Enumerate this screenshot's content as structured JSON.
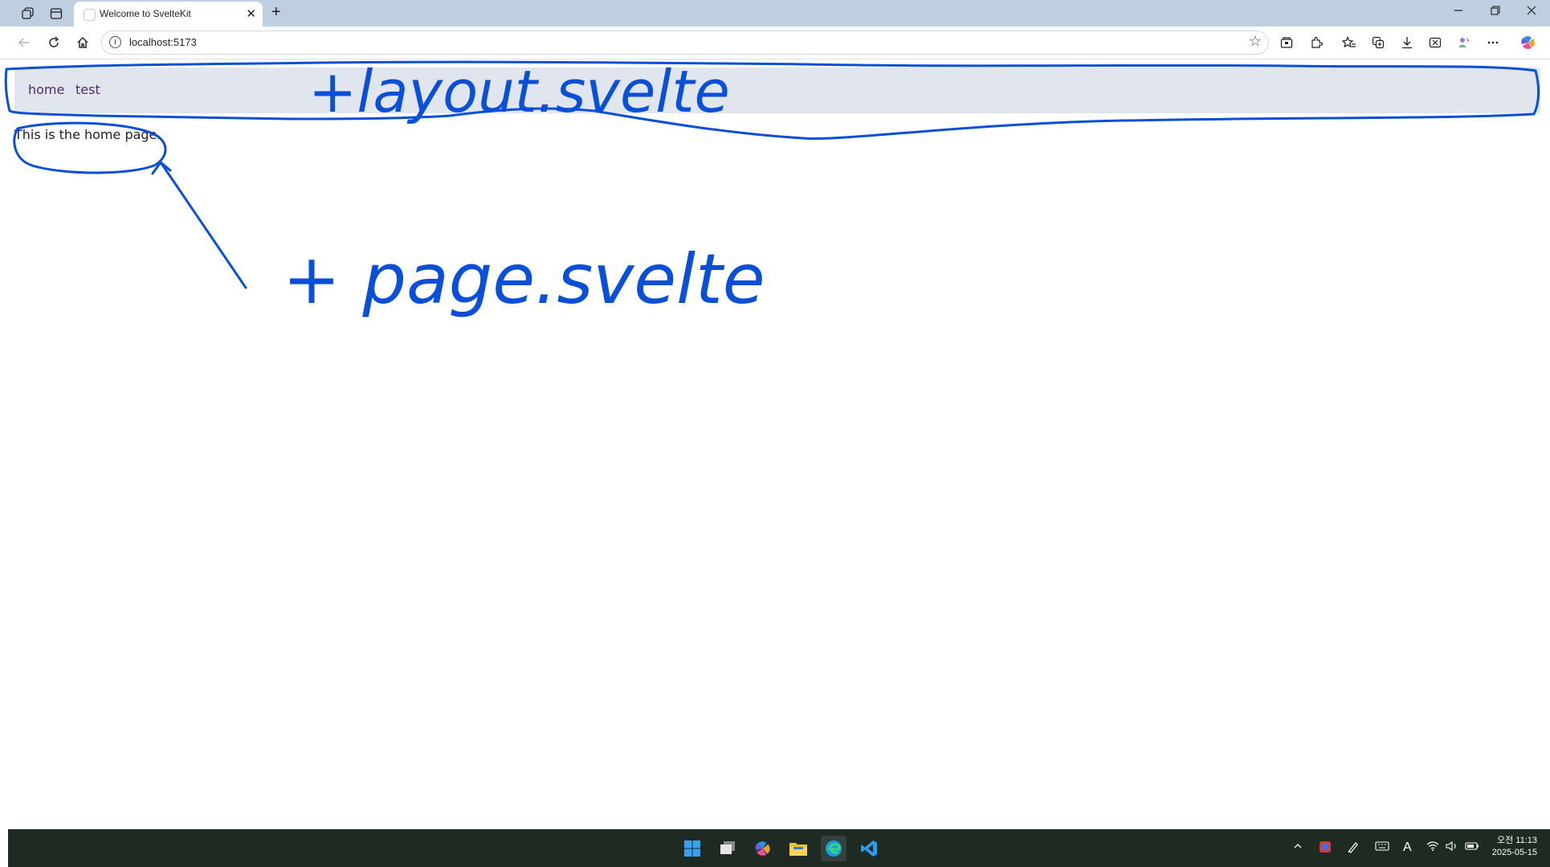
{
  "browser": {
    "tab_title": "Welcome to SvelteKit",
    "tab_close": "✕",
    "new_tab": "+",
    "url": "localhost:5173",
    "info_icon": "i"
  },
  "site": {
    "nav_links": [
      {
        "label": "home"
      },
      {
        "label": "test"
      }
    ],
    "page_text": "This is the home page."
  },
  "annotations": {
    "layout_label": "+layout.svelte",
    "page_label": "+ page.svelte",
    "ink_color": "#0a4fd8"
  },
  "taskbar": {
    "time": "오전 11:13",
    "date": "2025-05-15",
    "ime": "A"
  }
}
